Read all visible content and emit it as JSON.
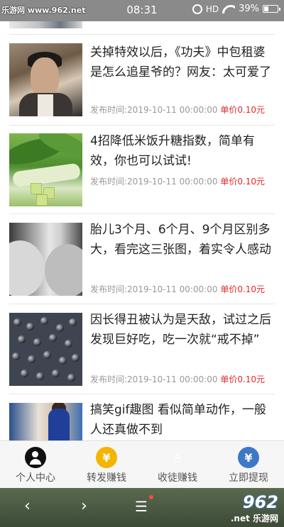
{
  "status_bar": {
    "watermark": "乐游网 www.962.net",
    "time": "08:31",
    "network": "HD",
    "battery": "39%",
    "icons": [
      "alarm-icon",
      "hd-icon",
      "wifi-icon",
      "battery-icon"
    ]
  },
  "articles": [
    {
      "title": "关掉特效以后，《功夫》中包租婆是怎么追星爷的？网友：太可爱了",
      "time": "发布时间:2019-10-11 00:00:00",
      "price": "单价0.10元"
    },
    {
      "title": "4招降低米饭升糖指数，简单有效，你也可以试试!",
      "time": "发布时间:2019-10-11 00:00:00",
      "price": "单价0.10元"
    },
    {
      "title": "胎儿3个月、6个月、9个月区别多大，看完这三张图，着实令人感动",
      "time": "发布时间:2019-10-11 00:00:00",
      "price": "单价0.10元"
    },
    {
      "title": "因长得丑被认为是天敌，试过之后发现巨好吃，吃一次就“戒不掉”",
      "time": "发布时间:2019-10-11 00:00:00",
      "price": "单价0.10元"
    },
    {
      "title": "搞笑gif趣图 看似简单动作，一般人还真做不到"
    }
  ],
  "tabs": [
    {
      "label": "个人中心",
      "icon": "user-icon"
    },
    {
      "label": "转发赚钱",
      "icon": "yuan-coin-icon",
      "glyph": "¥"
    },
    {
      "label": "收徒赚钱",
      "icon": "people-icon"
    },
    {
      "label": "立即提现",
      "icon": "money-bag-icon",
      "glyph": "¥"
    }
  ],
  "nav": {
    "back": "‹",
    "forward": "›",
    "menu": "☰",
    "watermark_big": "962",
    "watermark_small": ".net 乐游网"
  },
  "colors": {
    "price_red": "#e32b2b",
    "meta_gray": "#999999",
    "coin_yellow": "#f4b400",
    "accent_blue": "#3d78c9"
  }
}
